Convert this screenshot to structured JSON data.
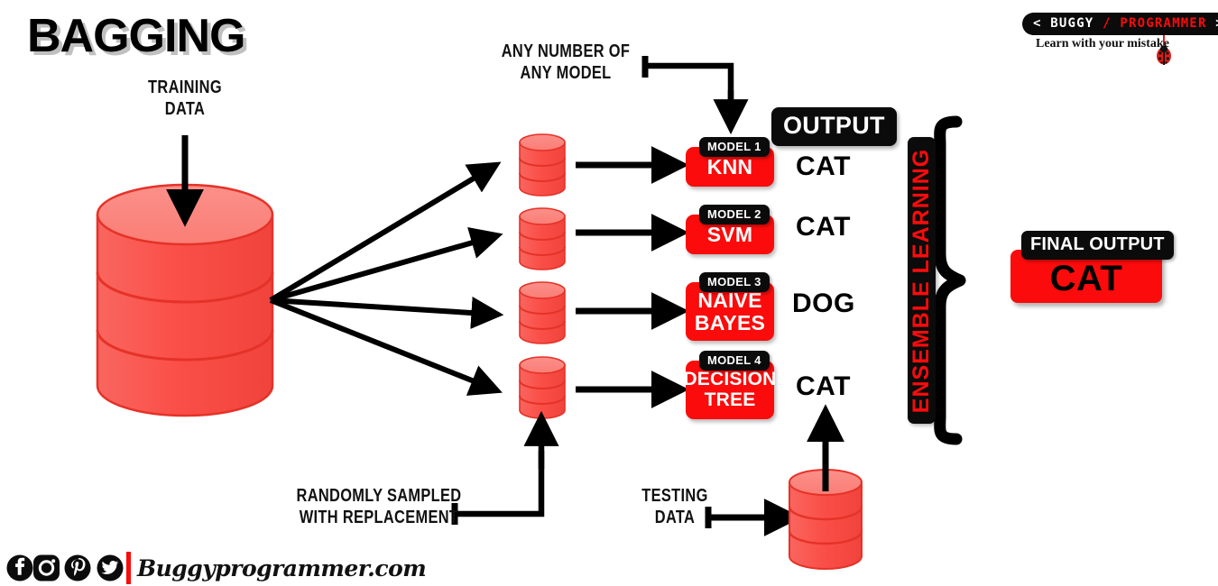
{
  "title": "BAGGING",
  "labels": {
    "training_data": "TRAINING\nDATA",
    "any_model": "ANY NUMBER OF\nANY MODEL",
    "output": "OUTPUT",
    "randomly_sampled": "RANDOMLY SAMPLED\nWITH REPLACEMENT",
    "testing_data": "TESTING\nDATA",
    "ensemble_learning": "ENSEMBLE LEARNING",
    "final_output_badge": "FINAL OUTPUT",
    "final_output_value": "CAT"
  },
  "models": [
    {
      "badge": "MODEL 1",
      "name": "KNN",
      "prediction": "CAT"
    },
    {
      "badge": "MODEL 2",
      "name": "SVM",
      "prediction": "CAT"
    },
    {
      "badge": "MODEL 3",
      "name": "NAIVE\nBAYES",
      "prediction": "DOG"
    },
    {
      "badge": "MODEL 4",
      "name": "DECISION\nTREE",
      "prediction": "CAT"
    }
  ],
  "logo": {
    "left_bracket": "<",
    "brand_first": "BUGGY",
    "brand_second": "/ PROGRAMMER",
    "right_bracket": ">",
    "tagline": "Learn with your mistake"
  },
  "footer": {
    "site": "Buggyprogrammer.com",
    "socials": [
      "facebook-icon",
      "instagram-icon",
      "pinterest-icon",
      "twitter-icon"
    ]
  },
  "colors": {
    "red": "#FB0B0B",
    "cylinder_body": "#F9554F",
    "cylinder_top": "#FA8079",
    "cylinder_edge": "#E02B20",
    "black": "#0B0B0B",
    "white": "#FFFFFF"
  },
  "chart_data": {
    "type": "diagram",
    "title": "BAGGING",
    "nodes": [
      "TRAINING DATA",
      "bootstrap samples x4",
      "MODEL 1 KNN",
      "MODEL 2 SVM",
      "MODEL 3 NAIVE BAYES",
      "MODEL 4 DECISION TREE",
      "TESTING DATA",
      "ENSEMBLE LEARNING",
      "FINAL OUTPUT CAT"
    ],
    "votes": {
      "CAT": 3,
      "DOG": 1
    },
    "final": "CAT"
  }
}
